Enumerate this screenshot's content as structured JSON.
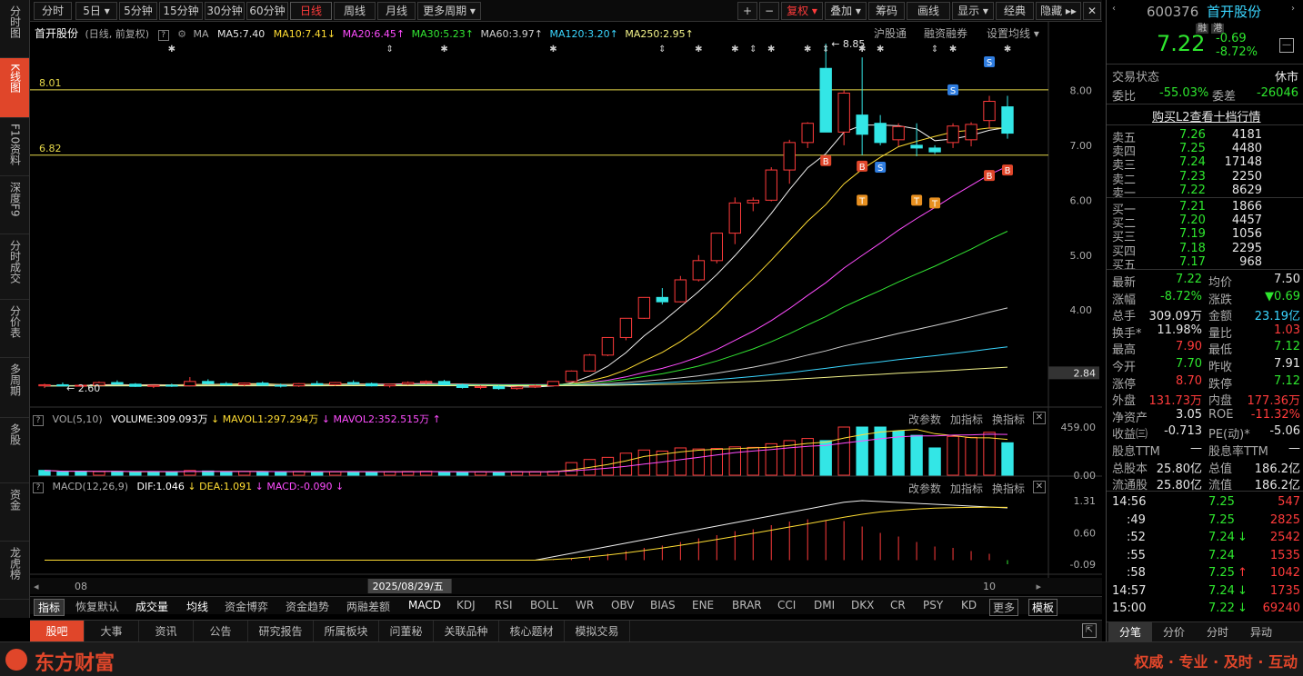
{
  "sidebar": {
    "items": [
      {
        "label": "分时图"
      },
      {
        "label": "K线图"
      },
      {
        "label": "F10资料"
      },
      {
        "label": "深度F9"
      },
      {
        "label": "分时成交"
      },
      {
        "label": "分价表"
      },
      {
        "label": "多周期"
      },
      {
        "label": "多股"
      },
      {
        "label": "资金"
      },
      {
        "label": "龙虎榜"
      }
    ]
  },
  "toolbar": {
    "periods": [
      "分时",
      "5日 ▾",
      "5分钟",
      "15分钟",
      "30分钟",
      "60分钟",
      "日线",
      "周线",
      "月线",
      "更多周期 ▾"
    ],
    "active_period": "日线",
    "tools": [
      "+",
      "−",
      "复权 ▾",
      "叠加 ▾",
      "筹码",
      "画线",
      "显示 ▾",
      "经典",
      "隐藏 ▸▸"
    ]
  },
  "chart_header": {
    "name": "首开股份",
    "mode": "(日线, 前复权)",
    "ma_label": "MA",
    "ma5": "MA5:7.40",
    "ma10": "MA10:7.41",
    "ma20": "MA20:6.45",
    "ma30": "MA30:5.23",
    "ma60": "MA60:3.97",
    "ma120": "MA120:3.20",
    "ma250": "MA250:2.95",
    "links": [
      "沪股通",
      "融资融券",
      "设置均线 ▾"
    ],
    "price_hi_label": "8.01",
    "price_lo_label": "6.82",
    "peak_label": "8.85",
    "low_label": "2.60",
    "current_price_tag": "2.84"
  },
  "chart_data": [
    {
      "type": "candlestick",
      "title": "首开股份 (日线, 前复权)",
      "y_ticks": [
        "8.00",
        "7.00",
        "6.00",
        "5.00",
        "4.00"
      ],
      "ylim": [
        2.3,
        8.95
      ],
      "x_ticks": [
        "08",
        "2025/08/29/五",
        "10"
      ],
      "ohlc": [
        [
          2.62,
          2.66,
          2.58,
          2.64
        ],
        [
          2.64,
          2.68,
          2.61,
          2.62
        ],
        [
          2.62,
          2.65,
          2.6,
          2.63
        ],
        [
          2.63,
          2.7,
          2.62,
          2.68
        ],
        [
          2.68,
          2.72,
          2.64,
          2.65
        ],
        [
          2.65,
          2.67,
          2.6,
          2.61
        ],
        [
          2.61,
          2.64,
          2.58,
          2.63
        ],
        [
          2.63,
          2.66,
          2.6,
          2.62
        ],
        [
          2.62,
          2.78,
          2.61,
          2.7
        ],
        [
          2.7,
          2.74,
          2.64,
          2.66
        ],
        [
          2.66,
          2.69,
          2.62,
          2.64
        ],
        [
          2.64,
          2.68,
          2.61,
          2.67
        ],
        [
          2.67,
          2.7,
          2.62,
          2.63
        ],
        [
          2.63,
          2.66,
          2.59,
          2.62
        ],
        [
          2.62,
          2.67,
          2.6,
          2.66
        ],
        [
          2.66,
          2.71,
          2.63,
          2.64
        ],
        [
          2.64,
          2.69,
          2.62,
          2.68
        ],
        [
          2.68,
          2.72,
          2.64,
          2.66
        ],
        [
          2.66,
          2.68,
          2.61,
          2.62
        ],
        [
          2.62,
          2.66,
          2.59,
          2.65
        ],
        [
          2.65,
          2.7,
          2.63,
          2.68
        ],
        [
          2.68,
          2.72,
          2.65,
          2.7
        ],
        [
          2.7,
          2.73,
          2.63,
          2.64
        ],
        [
          2.64,
          2.66,
          2.57,
          2.59
        ],
        [
          2.59,
          2.63,
          2.56,
          2.61
        ],
        [
          2.61,
          2.63,
          2.55,
          2.57
        ],
        [
          2.57,
          2.61,
          2.55,
          2.6
        ],
        [
          2.6,
          2.64,
          2.58,
          2.62
        ],
        [
          2.62,
          2.7,
          2.61,
          2.7
        ],
        [
          2.7,
          2.9,
          2.69,
          2.89
        ],
        [
          2.89,
          3.2,
          2.88,
          3.18
        ],
        [
          3.18,
          3.5,
          3.16,
          3.5
        ],
        [
          3.5,
          3.85,
          3.45,
          3.85
        ],
        [
          3.85,
          4.23,
          3.84,
          4.23
        ],
        [
          4.23,
          4.4,
          4.1,
          4.15
        ],
        [
          4.15,
          4.62,
          4.14,
          4.55
        ],
        [
          4.55,
          5.0,
          4.52,
          4.9
        ],
        [
          4.9,
          5.4,
          4.85,
          5.4
        ],
        [
          5.4,
          6.05,
          5.2,
          5.95
        ],
        [
          5.95,
          6.05,
          5.8,
          6.0
        ],
        [
          6.0,
          6.6,
          5.98,
          6.55
        ],
        [
          6.55,
          7.1,
          6.3,
          7.05
        ],
        [
          7.05,
          7.42,
          6.95,
          7.4
        ],
        [
          8.4,
          8.85,
          7.24,
          7.24
        ],
        [
          7.24,
          8.0,
          7.0,
          7.95
        ],
        [
          7.55,
          8.6,
          6.82,
          7.2
        ],
        [
          7.4,
          7.55,
          7.0,
          7.05
        ],
        [
          7.1,
          7.4,
          6.98,
          7.34
        ],
        [
          7.0,
          7.4,
          6.8,
          6.95
        ],
        [
          6.95,
          7.0,
          6.84,
          6.88
        ],
        [
          7.05,
          7.4,
          6.95,
          7.35
        ],
        [
          7.1,
          7.42,
          6.98,
          7.38
        ],
        [
          7.45,
          7.9,
          7.3,
          7.8
        ],
        [
          7.7,
          7.9,
          7.12,
          7.22
        ]
      ]
    },
    {
      "type": "bar",
      "title": "VOL(5,10)",
      "legend": [
        "VOLUME:309.093万",
        "MAVOL1:297.294万",
        "MAVOL2:352.515万"
      ],
      "y_ticks": [
        "459.00",
        "0.00"
      ],
      "ylim": [
        0,
        459
      ],
      "values": [
        46,
        30,
        38,
        34,
        36,
        28,
        35,
        30,
        45,
        40,
        33,
        35,
        30,
        32,
        36,
        30,
        33,
        35,
        30,
        34,
        36,
        38,
        30,
        28,
        32,
        30,
        34,
        33,
        36,
        120,
        150,
        170,
        210,
        240,
        230,
        260,
        250,
        255,
        270,
        265,
        300,
        330,
        350,
        330,
        459,
        459,
        459,
        420,
        380,
        260,
        370,
        360,
        409,
        309
      ],
      "down_days": [
        0,
        1,
        2,
        4,
        5,
        6,
        7,
        9,
        10,
        12,
        13,
        15,
        17,
        18,
        22,
        23,
        25,
        43,
        45,
        46,
        47,
        48,
        49,
        53
      ]
    },
    {
      "type": "bar",
      "title": "MACD(12,26,9)",
      "legend": [
        "DIF:1.046",
        "DEA:1.091",
        "MACD:-0.090"
      ],
      "y_ticks": [
        "1.31",
        "0.60",
        "-0.09"
      ],
      "ylim": [
        -0.15,
        1.45
      ],
      "macd": [
        0,
        0,
        0,
        0,
        0,
        0,
        0,
        0,
        0,
        0,
        0,
        0,
        0,
        0,
        0,
        0,
        0,
        0,
        0,
        0,
        0,
        0,
        0,
        0,
        0,
        0,
        0,
        0,
        0.01,
        0.04,
        0.08,
        0.14,
        0.2,
        0.27,
        0.32,
        0.4,
        0.48,
        0.55,
        0.64,
        0.68,
        0.77,
        0.85,
        0.9,
        0.87,
        0.86,
        0.74,
        0.6,
        0.52,
        0.4,
        0.3,
        0.27,
        0.2,
        0.14,
        -0.09
      ]
    }
  ],
  "chart_links": {
    "vol": [
      "改参数",
      "加指标",
      "换指标"
    ],
    "macd": [
      "改参数",
      "加指标",
      "换指标"
    ]
  },
  "indicator_row": {
    "items": [
      "指标",
      "恢复默认",
      "成交量",
      "均线",
      "资金博弈",
      "资金趋势",
      "两融差额",
      "MACD",
      "KDJ",
      "RSI",
      "BOLL",
      "WR",
      "OBV",
      "BIAS",
      "ENE",
      "BRAR",
      "CCI",
      "DMI",
      "DKX",
      "CR",
      "PSY",
      "KD",
      "更多",
      "模板"
    ]
  },
  "bottom_tabs": [
    "股吧",
    "大事",
    "资讯",
    "公告",
    "研究报告",
    "所属板块",
    "问董秘",
    "关联品种",
    "核心题材",
    "模拟交易"
  ],
  "brand": {
    "name": "东方财富",
    "slogan": "权威 · 专业 · 及时 · 互动"
  },
  "quote": {
    "code": "600376",
    "name": "首开股份",
    "tags": [
      "融",
      "港"
    ],
    "price": "7.22",
    "change": "-0.69",
    "change_pct": "-8.72%",
    "status_label": "交易状态",
    "status": "休市",
    "weibi_label": "委比",
    "weibi": "-55.03%",
    "weicha_label": "委差",
    "weicha": "-26046",
    "l2_link": "购买L2查看十档行情",
    "asks": [
      {
        "label": "卖五",
        "price": "7.26",
        "vol": "4181"
      },
      {
        "label": "卖四",
        "price": "7.25",
        "vol": "4480"
      },
      {
        "label": "卖三",
        "price": "7.24",
        "vol": "17148"
      },
      {
        "label": "卖二",
        "price": "7.23",
        "vol": "2250"
      },
      {
        "label": "卖一",
        "price": "7.22",
        "vol": "8629"
      }
    ],
    "bids": [
      {
        "label": "买一",
        "price": "7.21",
        "vol": "1866"
      },
      {
        "label": "买二",
        "price": "7.20",
        "vol": "4457"
      },
      {
        "label": "买三",
        "price": "7.19",
        "vol": "1056"
      },
      {
        "label": "买四",
        "price": "7.18",
        "vol": "2295"
      },
      {
        "label": "买五",
        "price": "7.17",
        "vol": "968"
      }
    ],
    "stats": [
      [
        "最新",
        "7.22",
        "均价",
        "7.50"
      ],
      [
        "涨幅",
        "-8.72%",
        "涨跌",
        "▼0.69"
      ],
      [
        "总手",
        "309.09万",
        "金额",
        "23.19亿"
      ],
      [
        "换手*",
        "11.98%",
        "量比",
        "1.03"
      ],
      [
        "最高",
        "7.90",
        "最低",
        "7.12"
      ],
      [
        "今开",
        "7.70",
        "昨收",
        "7.91"
      ],
      [
        "涨停",
        "8.70",
        "跌停",
        "7.12"
      ],
      [
        "外盘",
        "131.73万",
        "内盘",
        "177.36万"
      ],
      [
        "净资产",
        "3.05",
        "ROE",
        "-11.32%"
      ],
      [
        "收益㈢",
        "-0.713",
        "PE(动)*",
        "-5.06"
      ],
      [
        "股息TTM",
        "—",
        "股息率TTM",
        "—"
      ],
      [
        "总股本",
        "25.80亿",
        "总值",
        "186.2亿"
      ],
      [
        "流通股",
        "25.80亿",
        "流值",
        "186.2亿"
      ]
    ],
    "ticks": [
      {
        "time": "14:56",
        "price": "7.25",
        "vol": "547",
        "arrow": ""
      },
      {
        "time": ":49",
        "price": "7.25",
        "vol": "2825",
        "arrow": ""
      },
      {
        "time": ":52",
        "price": "7.24",
        "vol": "2542",
        "arrow": "↓"
      },
      {
        "time": ":55",
        "price": "7.24",
        "vol": "1535",
        "arrow": ""
      },
      {
        "time": ":58",
        "price": "7.25",
        "vol": "1042",
        "arrow": "↑"
      },
      {
        "time": "14:57",
        "price": "7.24",
        "vol": "1735",
        "arrow": "↓"
      },
      {
        "time": "15:00",
        "price": "7.22",
        "vol": "69240",
        "arrow": "↓"
      }
    ],
    "tabs": [
      "分笔",
      "分价",
      "分时",
      "异动"
    ]
  }
}
